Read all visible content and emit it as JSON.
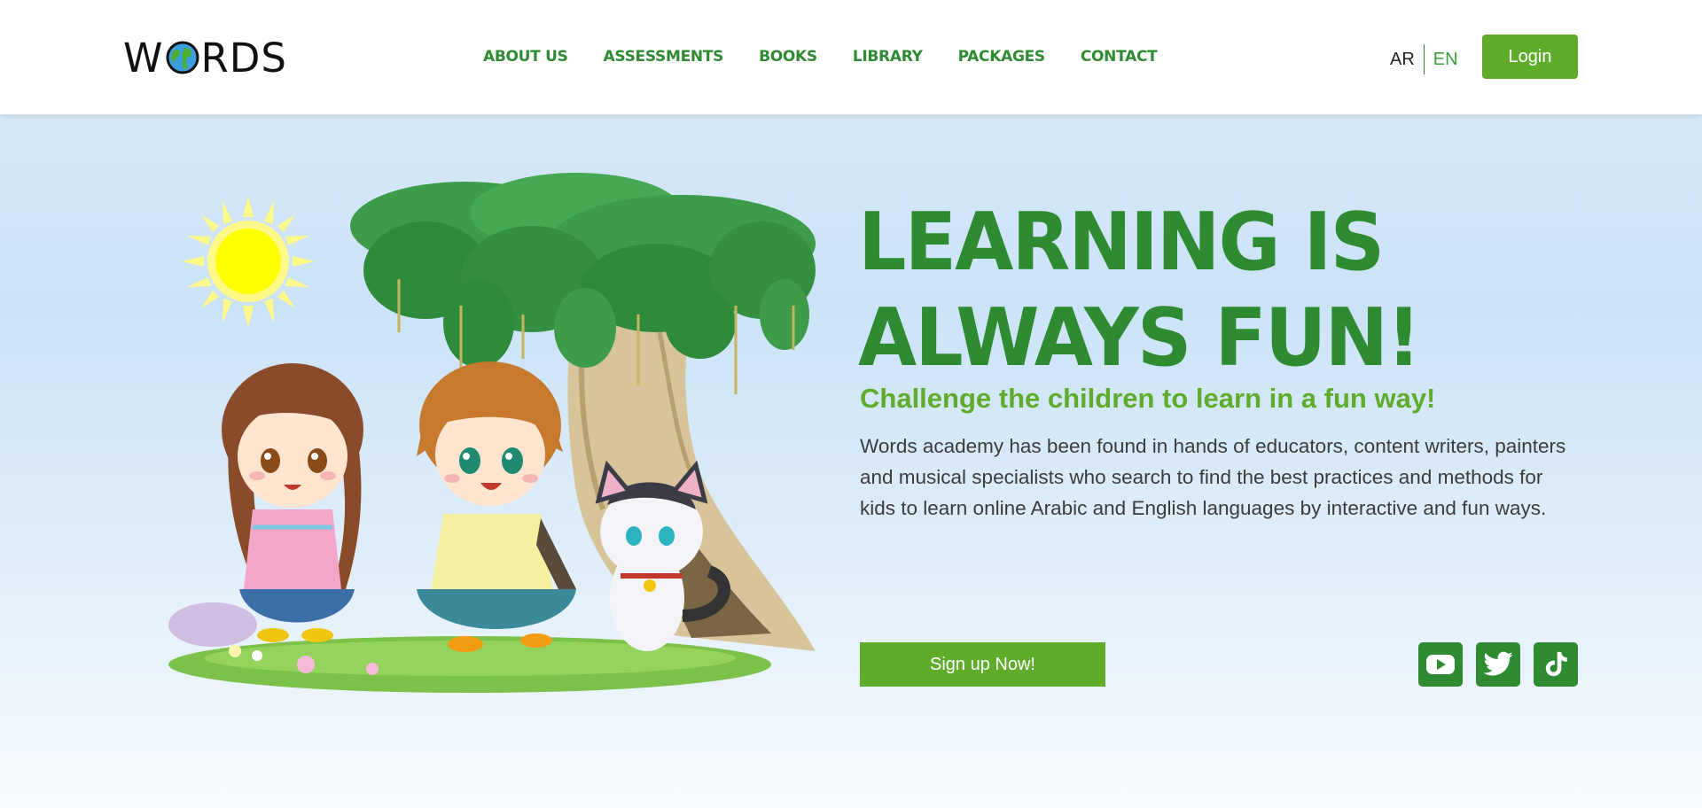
{
  "brand": {
    "logo_prefix": "W",
    "logo_suffix": "RDS",
    "logo_alt": "WORDS"
  },
  "nav": {
    "items": [
      {
        "label": "ABOUT US"
      },
      {
        "label": "ASSESSMENTS"
      },
      {
        "label": "BOOKS"
      },
      {
        "label": "LIBRARY"
      },
      {
        "label": "PACKAGES"
      },
      {
        "label": "CONTACT"
      }
    ]
  },
  "language": {
    "options": [
      "AR",
      "EN"
    ],
    "active": "EN"
  },
  "header": {
    "login_label": "Login"
  },
  "hero": {
    "title_line1": "LEARNING IS",
    "title_line2": "ALWAYS FUN!",
    "subtitle": "Challenge the children to learn in a fun way!",
    "description": "Words academy has been found in hands of educators, content writers, painters and musical specialists who search to find the best practices and methods for kids to learn online Arabic and English languages by interactive and fun ways.",
    "signup_label": "Sign up Now!"
  },
  "social": [
    {
      "icon": "youtube-icon"
    },
    {
      "icon": "twitter-icon"
    },
    {
      "icon": "tiktok-icon"
    }
  ],
  "colors": {
    "primary_green": "#2e8b32",
    "accent_green": "#5fac2a",
    "text_dark": "#3c3c3c",
    "sky_blue": "#cbe3f7"
  }
}
